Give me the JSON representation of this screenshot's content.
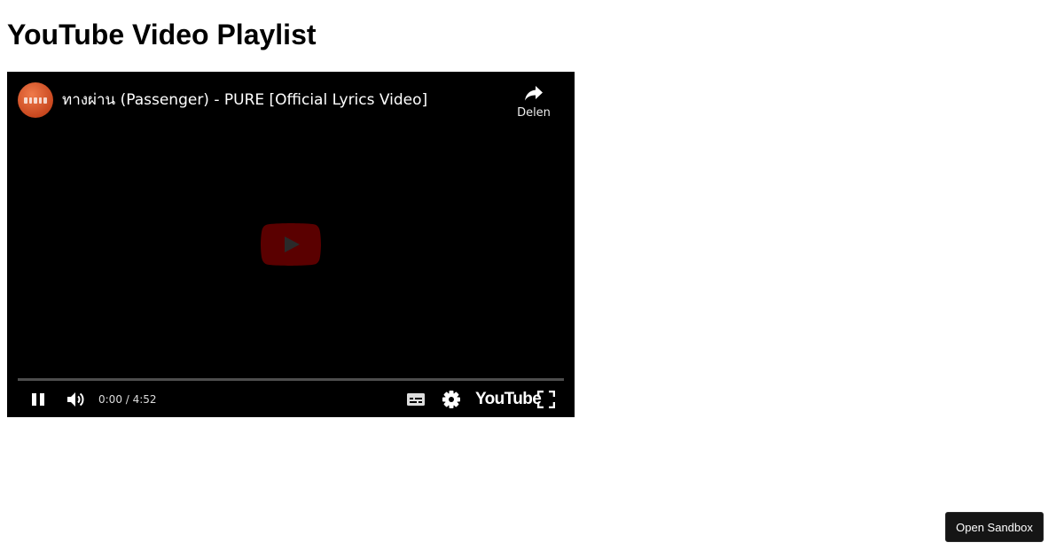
{
  "page": {
    "title": "YouTube Video Playlist"
  },
  "player": {
    "video_title": "ทางผ่าน (Passenger) - PURE [Official Lyrics Video]",
    "share_label": "Delen",
    "time_display": "0:00 / 4:52",
    "logo_text": "YouTube",
    "progress_fraction": 0,
    "icons": {
      "share": "share-arrow-icon",
      "play_overlay": "play-icon",
      "pause": "pause-icon",
      "volume": "volume-icon",
      "captions": "captions-icon",
      "settings": "gear-icon",
      "fullscreen": "fullscreen-icon"
    },
    "colors": {
      "progress": "#ff0000",
      "play_button": "#5a0000"
    }
  },
  "sandbox": {
    "button_label": "Open Sandbox"
  }
}
